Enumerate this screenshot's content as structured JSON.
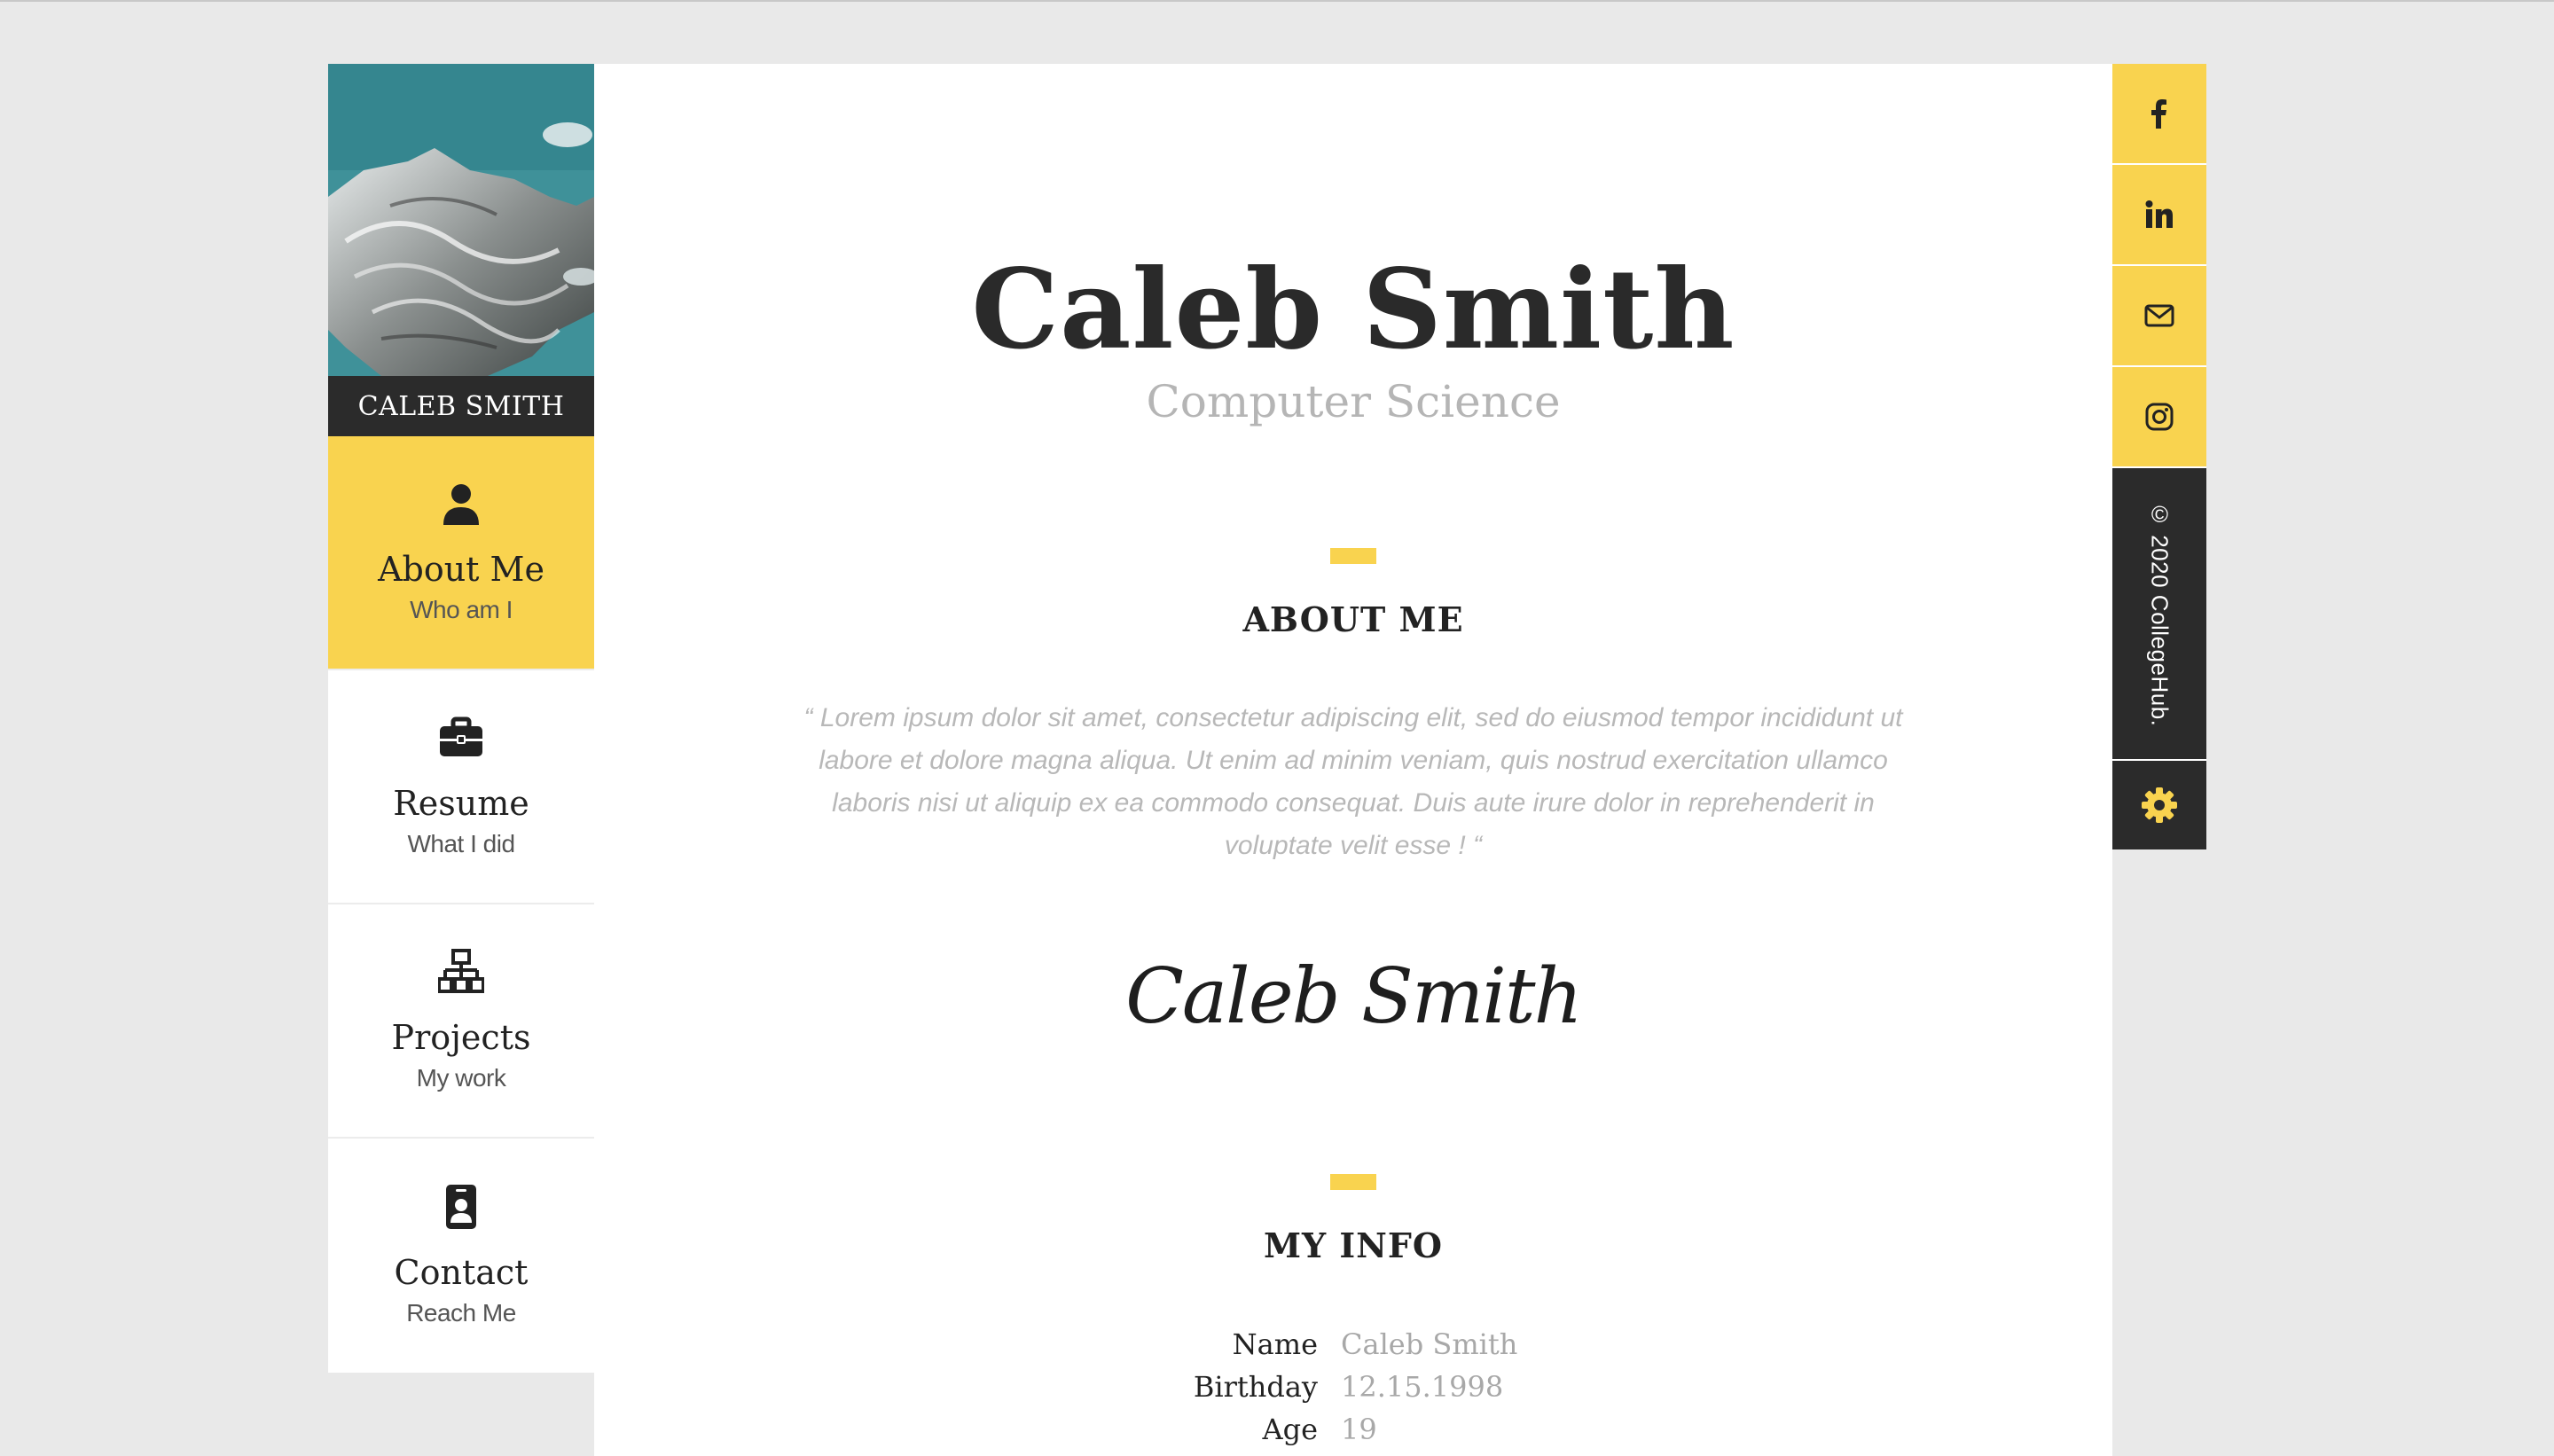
{
  "sidebar": {
    "profile_name": "CALEB SMITH",
    "items": [
      {
        "title": "About Me",
        "subtitle": "Who am I",
        "icon": "user-icon",
        "active": true
      },
      {
        "title": "Resume",
        "subtitle": "What I did",
        "icon": "briefcase-icon",
        "active": false
      },
      {
        "title": "Projects",
        "subtitle": "My work",
        "icon": "sitemap-icon",
        "active": false
      },
      {
        "title": "Contact",
        "subtitle": "Reach Me",
        "icon": "id-badge-icon",
        "active": false
      }
    ]
  },
  "main": {
    "name": "Caleb Smith",
    "field": "Computer Science",
    "about": {
      "title": "ABOUT ME",
      "quote": "“ Lorem ipsum dolor sit amet, consectetur adipiscing elit, sed do eiusmod tempor incididunt ut labore et dolore magna aliqua. Ut enim ad minim veniam, quis nostrud exercitation ullamco laboris nisi ut aliquip ex ea commodo consequat. Duis aute irure dolor in reprehenderit in voluptate velit esse ! “",
      "signature": "Caleb Smith"
    },
    "info": {
      "title": "MY INFO",
      "rows": [
        {
          "label": "Name",
          "value": "Caleb Smith"
        },
        {
          "label": "Birthday",
          "value": "12.15.1998"
        },
        {
          "label": "Age",
          "value": "19"
        }
      ]
    }
  },
  "social": {
    "buttons": [
      "facebook-icon",
      "linkedin-icon",
      "envelope-icon",
      "instagram-icon"
    ],
    "copyright": "© 2020 CollegeHub.",
    "settings_icon": "gear-icon"
  },
  "colors": {
    "accent": "#f9d34f",
    "dark": "#2b2b2b",
    "background": "#e9e9e9",
    "panel": "#ffffff",
    "muted_text": "#b5b5b5"
  }
}
